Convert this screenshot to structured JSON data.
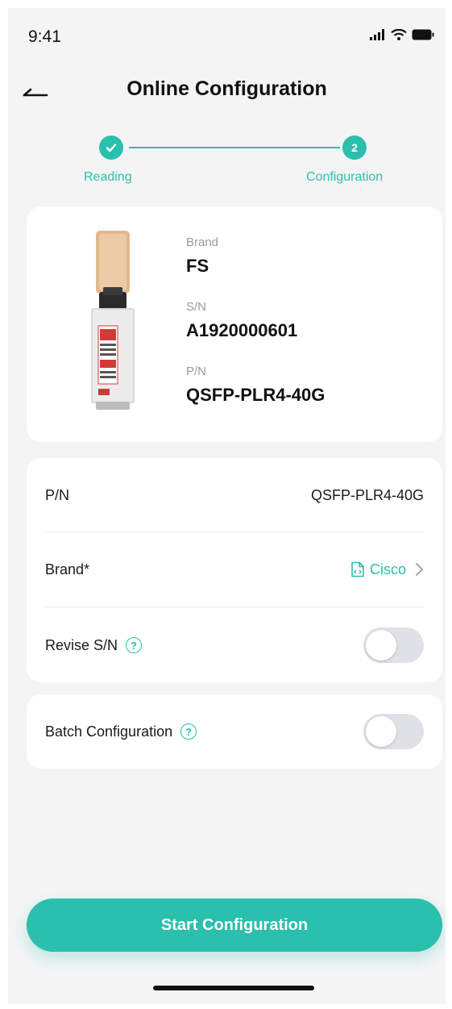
{
  "status_bar": {
    "time": "9:41"
  },
  "nav": {
    "title": "Online Configuration"
  },
  "stepper": {
    "steps": [
      {
        "label": "Reading",
        "state": "done",
        "marker": "✓"
      },
      {
        "label": "Configuration",
        "state": "active",
        "marker": "2"
      }
    ]
  },
  "product": {
    "brand_label": "Brand",
    "brand_value": "FS",
    "sn_label": "S/N",
    "sn_value": "A1920000601",
    "pn_label": "P/N",
    "pn_value": "QSFP-PLR4-40G"
  },
  "settings": {
    "pn_label": "P/N",
    "pn_value": "QSFP-PLR4-40G",
    "brand_label": "Brand*",
    "brand_value": "Cisco",
    "revise_sn_label": "Revise S/N",
    "revise_sn_on": false
  },
  "batch": {
    "label": "Batch Configuration",
    "on": false
  },
  "start_button": {
    "label": "Start Configuration"
  },
  "colors": {
    "accent": "#2bbfad",
    "background": "#f4f4f5",
    "card": "#ffffff",
    "toggle_off": "#dfe1e6"
  },
  "icons": [
    "back-arrow-icon",
    "checkmark-icon",
    "help-icon",
    "document-icon",
    "chevron-right-icon",
    "signal-icon",
    "wifi-icon",
    "battery-icon"
  ]
}
